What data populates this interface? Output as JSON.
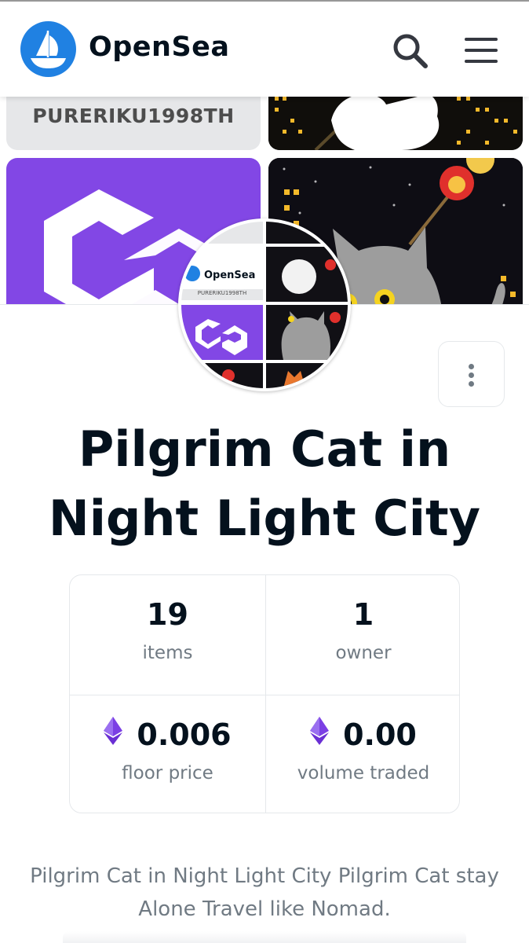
{
  "header": {
    "brand": "OpenSea",
    "logo_icon": "opensea-boat-icon",
    "search_icon": "search-icon",
    "menu_icon": "hamburger-menu-icon"
  },
  "banner": {
    "tile_text": "PURERIKU1998TH",
    "tile_icons": [
      "polygon-logo-icon",
      "cat-illustration-icon",
      "night-city-icon"
    ]
  },
  "avatar": {
    "brand": "OpenSea",
    "text": "PURERIKU1998TH"
  },
  "collection": {
    "title": "Pilgrim Cat in Night Light City",
    "description": "Pilgrim Cat in Night Light City Pilgrim Cat stay Alone Travel like Nomad."
  },
  "stats": {
    "items_value": "19",
    "items_label": "items",
    "owners_value": "1",
    "owners_label": "owner",
    "floor_value": "0.006",
    "floor_label": "floor price",
    "volume_value": "0.00",
    "volume_label": "volume traded",
    "currency_icon": "ethereum-icon"
  },
  "colors": {
    "brand_blue": "#2081e2",
    "title": "#04111d",
    "muted": "#707a83",
    "eth": "#7b3fe4",
    "polygon": "#8247e5"
  }
}
